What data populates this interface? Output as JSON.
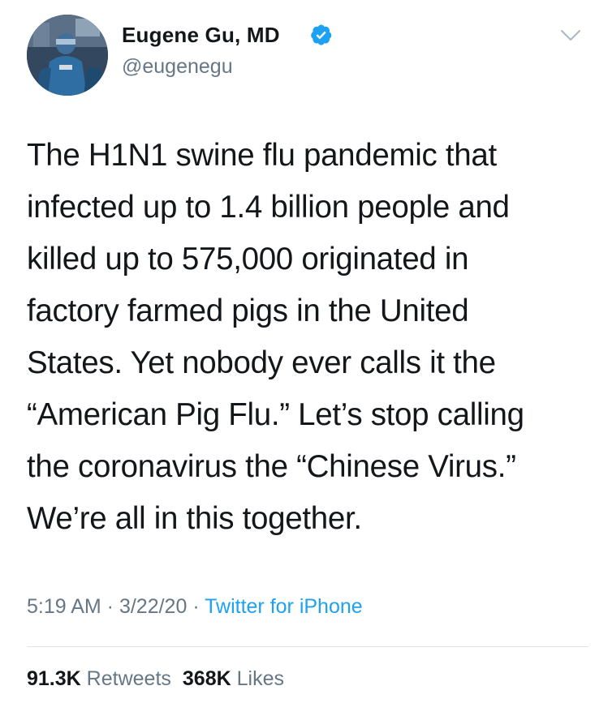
{
  "author": {
    "name": "Eugene Gu, MD",
    "handle": "@eugenegu",
    "verified": true,
    "verified_icon": "verified-badge-icon",
    "avatar_icon": "profile-avatar"
  },
  "menu": {
    "icon": "chevron-down-icon"
  },
  "tweet": {
    "lines": [
      "The H1N1 swine flu pandemic that",
      "infected up to 1.4 billion people and",
      "killed up to 575,000 originated in",
      "factory farmed pigs in the United",
      "States. Yet nobody ever calls it the",
      "“American Pig Flu.” Let’s stop calling",
      "the coronavirus the “Chinese Virus.”",
      "We’re all in this together."
    ]
  },
  "meta": {
    "time": "5:19 AM",
    "separator": " · ",
    "date": "3/22/20",
    "source": "Twitter for iPhone"
  },
  "stats": {
    "retweets_count": "91.3K",
    "retweets_label": "Retweets",
    "likes_count": "368K",
    "likes_label": "Likes"
  },
  "colors": {
    "text": "#14171a",
    "secondary": "#657786",
    "accent": "#1da1f2",
    "divider": "#dfe3e7"
  }
}
